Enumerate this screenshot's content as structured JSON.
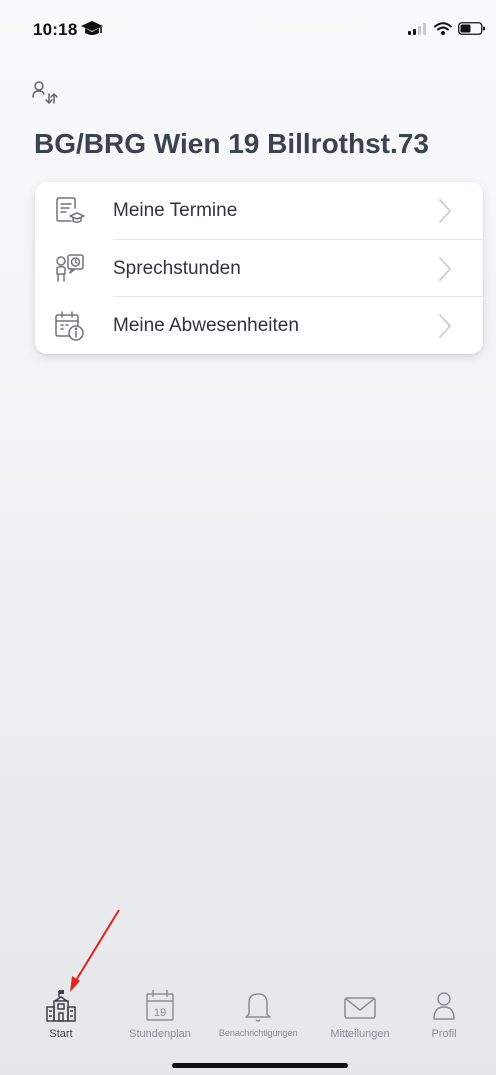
{
  "status_bar": {
    "time": "10:18"
  },
  "header": {
    "title": "BG/BRG Wien 19 Billrothst.73"
  },
  "menu": {
    "items": [
      {
        "label": "Meine Termine",
        "icon": "calendar-list-icon"
      },
      {
        "label": "Sprechstunden",
        "icon": "consultation-hours-icon"
      },
      {
        "label": "Meine Abwesenheiten",
        "icon": "absence-calendar-icon"
      }
    ]
  },
  "tab_bar": {
    "active": "Start",
    "calendar_day": "19",
    "tabs": [
      {
        "label": "Start",
        "icon": "school-building-icon"
      },
      {
        "label": "Stundenplan",
        "icon": "calendar-icon"
      },
      {
        "label": "Benachrichtigungen",
        "icon": "bell-icon"
      },
      {
        "label": "Mitteilungen",
        "icon": "envelope-icon"
      },
      {
        "label": "Profil",
        "icon": "person-icon"
      }
    ]
  },
  "colors": {
    "icon_gray": "#6f7580",
    "annotation_arrow": "#e0231c",
    "title": "#3c4350"
  }
}
